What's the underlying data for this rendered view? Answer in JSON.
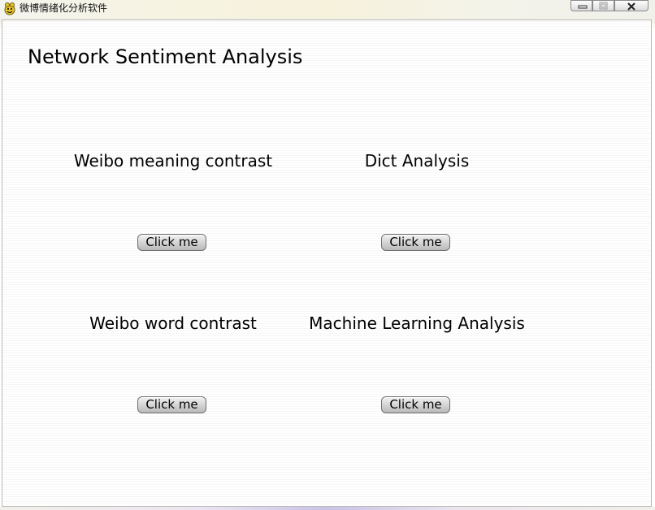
{
  "window": {
    "title": "微博情绪化分析软件",
    "controls": {
      "minimize": "minimize",
      "maximize": "maximize",
      "close": "close"
    }
  },
  "main": {
    "title": "Network Sentiment Analysis",
    "sections": [
      {
        "label": "Weibo meaning contrast",
        "button_label": "Click me"
      },
      {
        "label": "Dict Analysis",
        "button_label": "Click me"
      },
      {
        "label": "Weibo word contrast",
        "button_label": "Click me"
      },
      {
        "label": "Machine Learning Analysis",
        "button_label": "Click me"
      }
    ]
  },
  "icons": {
    "app": "pygame-snake-icon",
    "minimize": "minimize-icon",
    "maximize": "maximize-icon",
    "close": "close-icon"
  }
}
